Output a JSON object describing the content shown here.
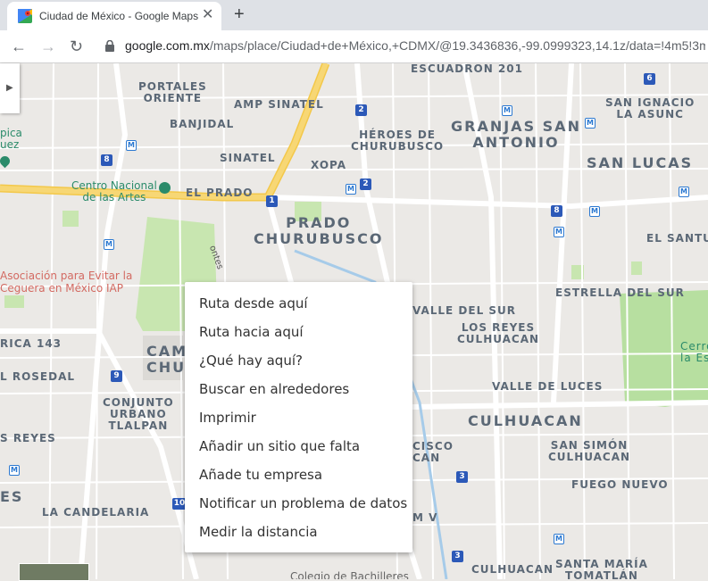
{
  "tab": {
    "title": "Ciudad de México - Google Maps"
  },
  "address_bar": {
    "host": "google.com.mx",
    "path": "/maps/place/Ciudad+de+México,+CDMX/@19.3436836,-99.0999323,14.1z/data=!4m5!3m"
  },
  "icons": {
    "back": "arrow-left-icon",
    "forward": "arrow-right-icon",
    "reload": "reload-icon",
    "lock": "lock-icon",
    "close": "close-icon",
    "new_tab": "plus-icon",
    "favicon": "google-maps-favicon"
  },
  "map_labels": {
    "escuadron": "ESCUADRON 201",
    "portales_oriente": "PORTALES\nORIENTE",
    "amp_sinatel": "AMP SINATEL",
    "banjidal": "BANJIDAL",
    "heroes": "HÉROES DE\nCHURUBUSCO",
    "granjas": "GRANJAS SAN\nANTONIO",
    "san_ignacio": "SAN IGNACIO\nLA ASUNC",
    "sinatel": "SINATEL",
    "xopa": "XOPA",
    "san_lucas": "SAN LUCAS",
    "el_prado": "EL PRADO",
    "centro_artes": "Centro Nacional\nde las Artes",
    "prado_churubusco": "PRADO\nCHURUBUSCO",
    "el_santu": "EL SANTU",
    "estrella": "ESTRELLA DEL SUR",
    "asociacion": "Asociación para Evitar la\nCeguera en México IAP",
    "montes": "ontes",
    "valle_sur": "VALLE DEL SUR",
    "los_reyes_culhuacan": "LOS REYES\nCULHUACAN",
    "cerro": "Cerro\nla Est",
    "rica": "RICA 143",
    "cam": "CAM\nCHU",
    "rosedal": "L ROSEDAL",
    "valle_luces": "VALLE DE LUCES",
    "conjunto": "CONJUNTO\nURBANO\nTLALPAN",
    "culhuacan": "CULHUACAN",
    "s_reyes": "S REYES",
    "cisco": "CISCO\nCAN",
    "san_simon": "SAN SIMÓN\nCULHUACAN",
    "es": "ES",
    "fuego_nuevo": "FUEGO NUEVO",
    "la_candelaria": "LA CANDELARIA",
    "mv": "M V",
    "colegio": "Colegio de Bachilleres",
    "culhuacan2": "CULHUACAN",
    "santa_maria": "SANTA MARÍA\nTOMATLÁN",
    "pica": "pica\nuez"
  },
  "route_pins": [
    "2",
    "8",
    "M",
    "M",
    "M",
    "M",
    "2",
    "1",
    "8",
    "M",
    "M",
    "M",
    "6",
    "M",
    "9",
    "10",
    "3",
    "3",
    "M",
    "M"
  ],
  "context_menu": {
    "items": [
      "Ruta desde aquí",
      "Ruta hacia aquí",
      "¿Qué hay aquí?",
      "Buscar en alrededores",
      "Imprimir",
      "Añadir un sitio que falta",
      "Añade tu empresa",
      "Notificar un problema de datos",
      "Medir la distancia"
    ]
  },
  "colors": {
    "map_bg": "#ebe9e6",
    "park": "#c8e6b0",
    "road": "#ffffff",
    "highway": "#f7d775",
    "water": "#a6cbe9",
    "accent": "#1a73e8"
  }
}
